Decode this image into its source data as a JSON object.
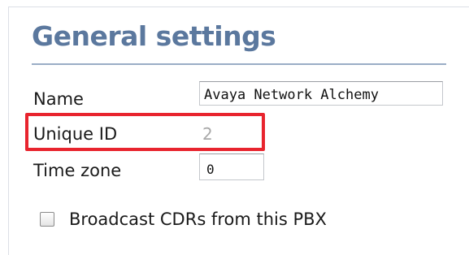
{
  "section": {
    "title": "General settings"
  },
  "fields": {
    "name": {
      "label": "Name",
      "value": "Avaya Network Alchemy"
    },
    "unique_id": {
      "label": "Unique ID",
      "value": "2"
    },
    "time_zone": {
      "label": "Time zone",
      "value": "0"
    }
  },
  "broadcast": {
    "label": "Broadcast CDRs from this PBX",
    "checked": false
  },
  "colors": {
    "title": "#5b789e",
    "highlight": "#e8242e",
    "rule": "#9aadc6"
  }
}
